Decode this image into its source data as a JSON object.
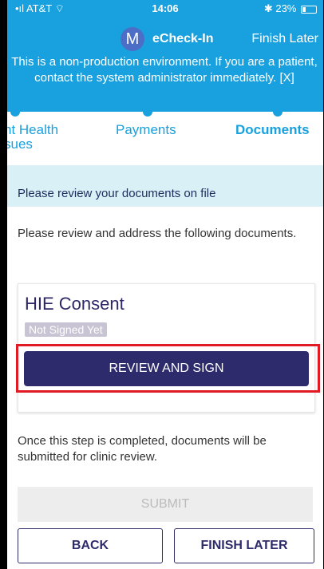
{
  "status_bar": {
    "carrier": "AT&T",
    "time": "14:06",
    "battery": "23%"
  },
  "header": {
    "avatar_letter": "M",
    "title": "eCheck-In",
    "finish_later": "Finish Later"
  },
  "banner": {
    "text": "This is a non-production environment. If you are a patient, contact the system administrator immediately. [X]"
  },
  "steps": [
    {
      "label": "nt Health\nsues",
      "active": false
    },
    {
      "label": "Payments",
      "active": false
    },
    {
      "label": "Documents",
      "active": true
    }
  ],
  "notice": "Please review your documents on file",
  "intro": "Please review and address the following documents.",
  "document": {
    "title": "HIE Consent",
    "status": "Not Signed Yet",
    "action": "REVIEW AND SIGN"
  },
  "after_text": "Once this step is completed, documents will be submitted for clinic review.",
  "buttons": {
    "submit": "SUBMIT",
    "back": "BACK",
    "finish_later": "FINISH LATER"
  },
  "colors": {
    "brand": "#19a0de",
    "primary": "#2d2b6b",
    "highlight": "#e11a23"
  }
}
